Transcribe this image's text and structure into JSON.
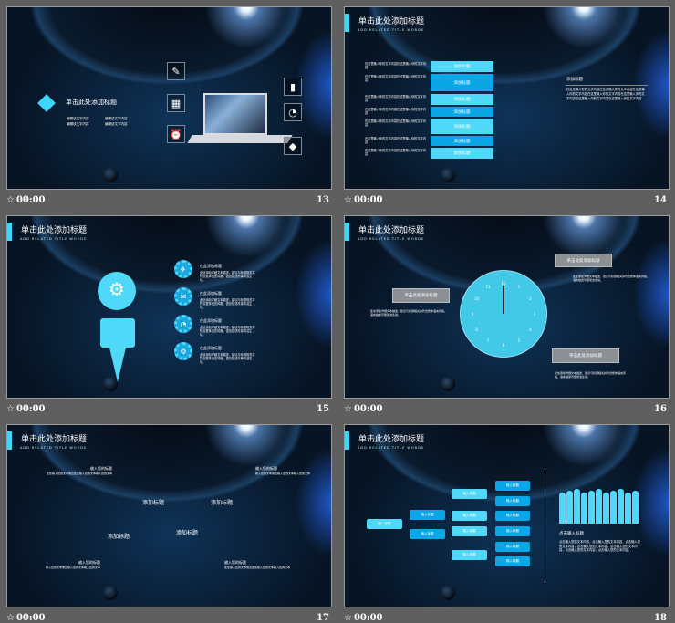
{
  "common": {
    "title": "单击此处添加标题",
    "subtitle": "ADD RELATED TITLE WORDS",
    "time": "00:00",
    "star_icon": "star-icon"
  },
  "slides": [
    {
      "number": "13",
      "title": "单击此处添加标题",
      "items": [
        "编辑该文字内容",
        "编辑该文字内容",
        "编辑该文字内容",
        "编辑该文字内容"
      ]
    },
    {
      "number": "14",
      "boxes": [
        "添加标题",
        "添加标题",
        "添加标题",
        "添加标题",
        "添加标题",
        "添加标题",
        "添加标题"
      ],
      "left_texts": [
        "在这里输入你的文字内容在这里输入你的文字内容",
        "在这里输入你的文字内容在这里输入你的文字内容",
        "在这里输入你的文字内容在这里输入你的文字内容",
        "在这里输入你的文字内容在这里输入你的文字内容",
        "在这里输入你的文字内容在这里输入你的文字内容",
        "在这里输入你的文字内容在这里输入你的文字内容",
        "在这里输入你的文字内容在这里输入你的文字内容"
      ],
      "right_title": "添加标题",
      "right_text": "在这里输入你的文字内容在这里输入你的文字内容在这里输入你的文字内容在这里输入你的文字内容在这里输入你的文字内容在这里输入你的文字内容在这里输入你的文字内容"
    },
    {
      "number": "15",
      "items": [
        {
          "title": "在此添加标题",
          "text": "此处添加详细文本描述，建议与标题相关并符合整体语言风格，语言描述尽量简洁生动。"
        },
        {
          "title": "在此添加标题",
          "text": "此处添加详细文本描述，建议与标题相关并符合整体语言风格，语言描述尽量简洁生动。"
        },
        {
          "title": "在此添加标题",
          "text": "此处添加详细文本描述，建议与标题相关并符合整体语言风格，语言描述尽量简洁生动。"
        },
        {
          "title": "在此添加标题",
          "text": "此处添加详细文本描述，建议与标题相关并符合整体语言风格，语言描述尽量简洁生动。"
        }
      ]
    },
    {
      "number": "16",
      "labels": [
        {
          "title": "单击此处添加标题",
          "text": "此处添加详细文本描述，建议与标题相关并符合整体语言风格，语言描述尽量简洁生动。"
        },
        {
          "title": "单击此处添加标题",
          "text": "此处添加详细文本描述，建议与标题相关并符合整体语言风格，语言描述尽量简洁生动。"
        },
        {
          "title": "单击此处添加标题",
          "text": "此处添加详细文本描述，建议与标题相关并符合整体语言风格，语言描述尽量简洁生动。"
        }
      ],
      "clock_numbers": [
        "12",
        "1",
        "2",
        "3",
        "4",
        "5",
        "6",
        "7",
        "8",
        "9",
        "10",
        "11"
      ]
    },
    {
      "number": "17",
      "shapes": [
        "添加标题",
        "添加标题",
        "添加标题",
        "添加标题"
      ],
      "notes": [
        {
          "title": "输入您的标题",
          "text": "此处输入您的文本信息此处输入您的文本输入您的文本"
        },
        {
          "title": "输入您的标题",
          "text": "输入您的文本信息输入您的文本输入您的文本"
        },
        {
          "title": "输入您的标题",
          "text": "输入您的文本信息输入您的文本输入您的文本"
        },
        {
          "title": "输入您的标题",
          "text": "此处输入您的文本信息此处输入您的文本输入您的文本"
        }
      ]
    },
    {
      "number": "18",
      "root": "输入标题",
      "level2": [
        "输入标题",
        "输入标题"
      ],
      "level3": [
        "输入标题",
        "输入标题",
        "输入标题",
        "输入标题"
      ],
      "level4": [
        "输入标题",
        "输入标题",
        "输入标题",
        "输入标题",
        "输入标题",
        "输入标题"
      ],
      "right_title": "点击输入标题",
      "right_text": "点击输入您的文本内容，点击输入您的文本内容，点击输入您的文本内容，点击输入您的文本内容。点击输入您的文本内容，点击输入您的文本内容，点击输入您的文本内容。"
    }
  ],
  "colors": {
    "light": "#4fd8f7",
    "dark": "#0aa7e6",
    "bg": "#5f5f5f"
  }
}
